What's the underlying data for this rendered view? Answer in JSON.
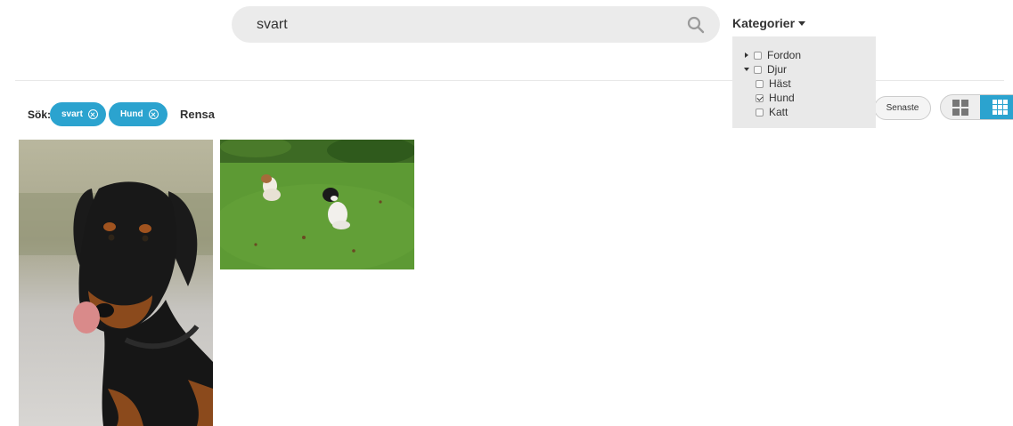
{
  "search": {
    "value": "svart"
  },
  "categories": {
    "label": "Kategorier",
    "items": [
      {
        "label": "Fordon",
        "expanded": false,
        "checked": false
      },
      {
        "label": "Djur",
        "expanded": true,
        "checked": false,
        "children": [
          {
            "label": "Häst",
            "checked": false
          },
          {
            "label": "Hund",
            "checked": true
          },
          {
            "label": "Katt",
            "checked": false
          }
        ]
      }
    ]
  },
  "filters": {
    "label": "Sök:",
    "chips": [
      {
        "label": "svart"
      },
      {
        "label": "Hund"
      }
    ],
    "clear_label": "Rensa"
  },
  "sort": {
    "label": "Senaste"
  },
  "view": {
    "modes": [
      "large-grid",
      "small-grid"
    ],
    "active": "small-grid"
  },
  "colors": {
    "accent": "#2ba3cf",
    "search_bg": "#ebebeb",
    "panel_bg": "#e9e9e9"
  },
  "results": [
    {
      "subject": "doberman-portrait"
    },
    {
      "subject": "two-puppies-on-grass"
    }
  ]
}
